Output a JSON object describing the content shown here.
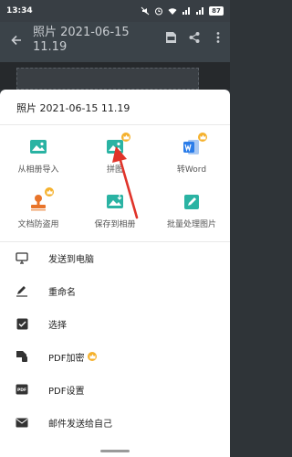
{
  "status_bar": {
    "time": "13:34",
    "battery": "87"
  },
  "app_bar": {
    "title": "照片 2021-06-15 11.19"
  },
  "sheet": {
    "title": "照片 2021-06-15 11.19",
    "grid": [
      {
        "label": "从相册导入",
        "icon": "image-import-icon",
        "premium": false
      },
      {
        "label": "拼图",
        "icon": "collage-icon",
        "premium": true
      },
      {
        "label": "转Word",
        "icon": "word-icon",
        "premium": true
      },
      {
        "label": "文档防盗用",
        "icon": "stamp-icon",
        "premium": true
      },
      {
        "label": "保存到相册",
        "icon": "save-to-album-icon",
        "premium": false
      },
      {
        "label": "批量处理图片",
        "icon": "batch-edit-icon",
        "premium": false
      }
    ],
    "list": [
      {
        "label": "发送到电脑",
        "icon": "monitor-icon",
        "premium": false
      },
      {
        "label": "重命名",
        "icon": "pen-icon",
        "premium": false
      },
      {
        "label": "选择",
        "icon": "checkbox-icon",
        "premium": false
      },
      {
        "label": "PDF加密",
        "icon": "pdf-lock-icon",
        "premium": true
      },
      {
        "label": "PDF设置",
        "icon": "pdf-icon",
        "premium": false
      },
      {
        "label": "邮件发送给自己",
        "icon": "mail-icon",
        "premium": false
      }
    ]
  },
  "colors": {
    "accent_teal": "#2ab3a3",
    "word_blue": "#2b7de9",
    "stamp_orange": "#e8742a",
    "crown_gold": "#f5b12c",
    "arrow_red": "#e0342a"
  }
}
